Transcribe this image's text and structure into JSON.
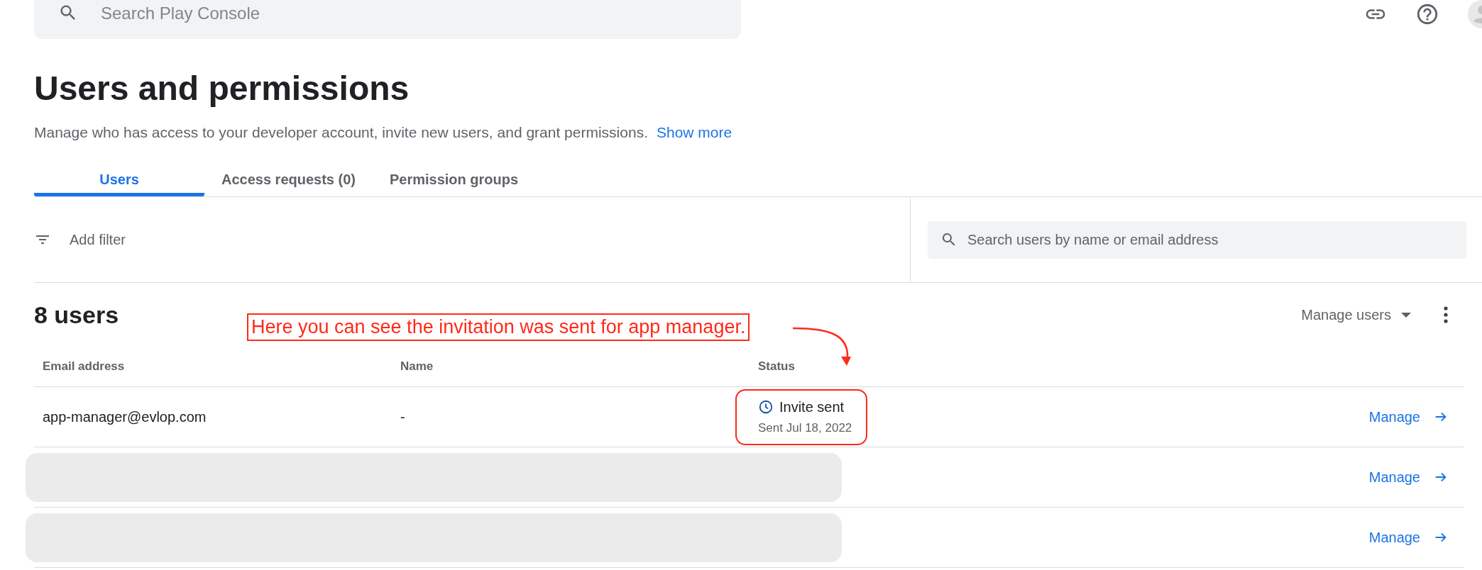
{
  "top_bar": {
    "search": {
      "placeholder": "Search Play Console"
    }
  },
  "page": {
    "title": "Users and permissions",
    "description": "Manage who has access to your developer account, invite new users, and grant permissions.",
    "show_more": "Show more"
  },
  "tabs": [
    {
      "label": "Users",
      "selected": true
    },
    {
      "label": "Access requests (0)",
      "selected": false
    },
    {
      "label": "Permission groups",
      "selected": false
    }
  ],
  "filter": {
    "label": "Add filter"
  },
  "user_search": {
    "placeholder": "Search users by name or email address"
  },
  "users": {
    "count": "8 users",
    "manage_users": "Manage users"
  },
  "annotation": {
    "text": "Here you can see the invitation was sent for app manager."
  },
  "table": {
    "columns": [
      "Email address",
      "Name",
      "Status"
    ],
    "rows": [
      {
        "kind": "user",
        "email": "app-manager@evlop.com",
        "name": "-",
        "status": "Invite sent",
        "status_date": "Sent Jul 18, 2022",
        "highlighted": true,
        "action": "Manage"
      },
      {
        "kind": "redacted",
        "action": "Manage"
      },
      {
        "kind": "redacted",
        "action": "Manage"
      }
    ]
  }
}
